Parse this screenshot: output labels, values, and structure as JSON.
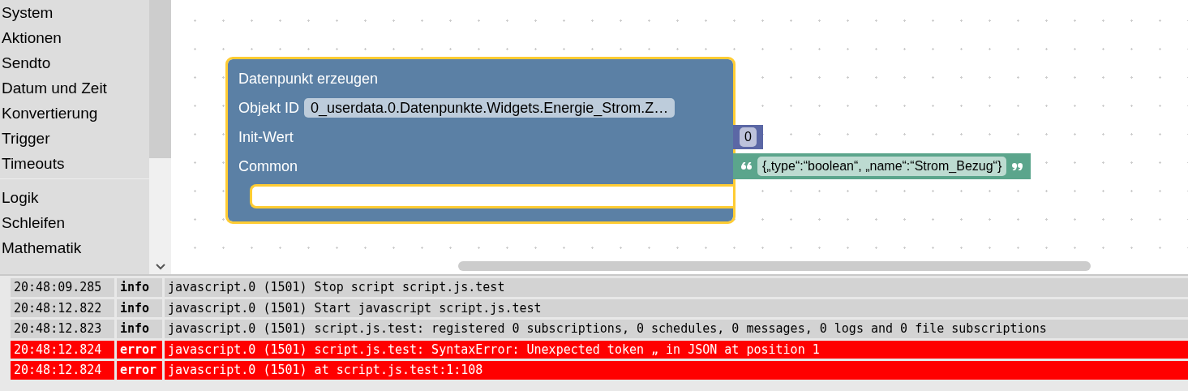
{
  "sidebar": {
    "groups": [
      {
        "items": [
          {
            "label": "System"
          },
          {
            "label": "Aktionen"
          },
          {
            "label": "Sendto"
          },
          {
            "label": "Datum und Zeit"
          },
          {
            "label": "Konvertierung"
          },
          {
            "label": "Trigger"
          },
          {
            "label": "Timeouts"
          }
        ]
      },
      {
        "items": [
          {
            "label": "Logik"
          },
          {
            "label": "Schleifen"
          },
          {
            "label": "Mathematik"
          }
        ]
      }
    ]
  },
  "workspace": {
    "block": {
      "title": "Datenpunkt erzeugen",
      "selected": true,
      "inputs": [
        {
          "label": "Objekt ID",
          "field": "0_userdata.0.Datenpunkte.Widgets.Energie_Strom.Z…"
        },
        {
          "label": "Init-Wert",
          "attached": {
            "kind": "number",
            "value": "0",
            "selected": false
          }
        },
        {
          "label": "Common",
          "attached": {
            "kind": "text",
            "value": "{„type“:“boolean“, „name“:“Strom_Bezug“}",
            "selected": false
          }
        }
      ]
    }
  },
  "log": [
    {
      "time": "20:48:09.285",
      "kind": "info",
      "level": "info",
      "message": "javascript.0 (1501) Stop script script.js.test"
    },
    {
      "time": "20:48:12.822",
      "kind": "info",
      "level": "info",
      "message": "javascript.0 (1501) Start javascript script.js.test"
    },
    {
      "time": "20:48:12.823",
      "kind": "info",
      "level": "info",
      "message": "javascript.0 (1501) script.js.test: registered 0 subscriptions, 0 schedules, 0 messages, 0 logs and 0 file subscriptions"
    },
    {
      "time": "20:48:12.824",
      "kind": "error",
      "level": "error",
      "message": "javascript.0 (1501) script.js.test: SyntaxError: Unexpected token „ in JSON at position 1"
    },
    {
      "time": "20:48:12.824",
      "kind": "error",
      "level": "error",
      "message": "javascript.0 (1501) at script.js.test:1:108"
    }
  ]
}
